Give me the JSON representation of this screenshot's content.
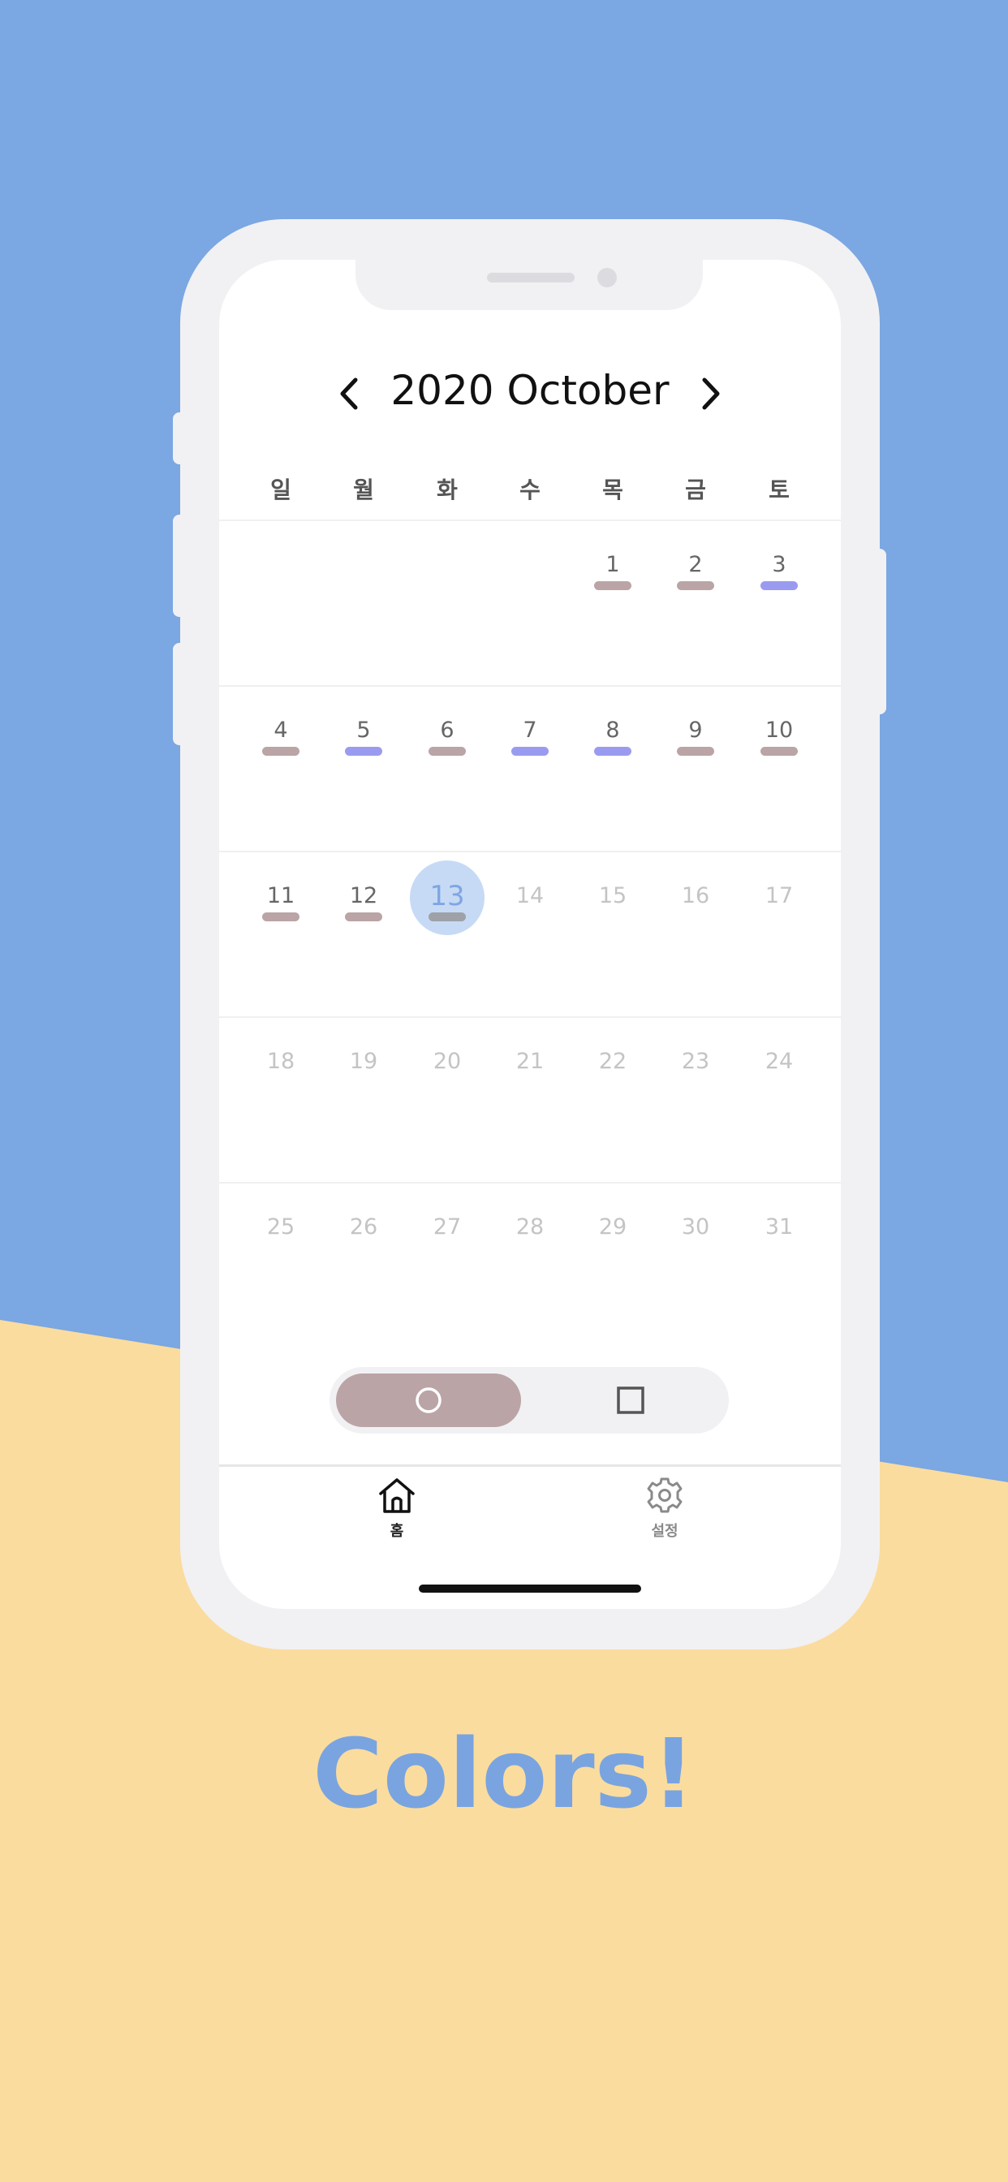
{
  "colors": {
    "background_top": "#7ba7e2",
    "background_bottom": "#fbdc9f",
    "bar_brown": "#bba4a6",
    "bar_purple": "#9a9bf0",
    "bar_gray": "#9ea1a7",
    "today_highlight": "#c6daf5",
    "tagline": "#79a4e0"
  },
  "header": {
    "month_title": "2020 October",
    "prev_icon": "chevron-left-icon",
    "next_icon": "chevron-right-icon"
  },
  "weekdays": [
    "일",
    "월",
    "화",
    "수",
    "목",
    "금",
    "토"
  ],
  "calendar": {
    "weeks": [
      [
        {
          "label": ""
        },
        {
          "label": ""
        },
        {
          "label": ""
        },
        {
          "label": ""
        },
        {
          "label": "1",
          "mark": "brown"
        },
        {
          "label": "2",
          "mark": "brown"
        },
        {
          "label": "3",
          "mark": "purple"
        }
      ],
      [
        {
          "label": "4",
          "mark": "brown"
        },
        {
          "label": "5",
          "mark": "purple"
        },
        {
          "label": "6",
          "mark": "brown"
        },
        {
          "label": "7",
          "mark": "purple"
        },
        {
          "label": "8",
          "mark": "purple"
        },
        {
          "label": "9",
          "mark": "brown"
        },
        {
          "label": "10",
          "mark": "brown"
        }
      ],
      [
        {
          "label": "11",
          "mark": "brown"
        },
        {
          "label": "12",
          "mark": "brown"
        },
        {
          "label": "13",
          "mark": "gray",
          "today": true
        },
        {
          "label": "14",
          "future": true
        },
        {
          "label": "15",
          "future": true
        },
        {
          "label": "16",
          "future": true
        },
        {
          "label": "17",
          "future": true
        }
      ],
      [
        {
          "label": "18",
          "future": true
        },
        {
          "label": "19",
          "future": true
        },
        {
          "label": "20",
          "future": true
        },
        {
          "label": "21",
          "future": true
        },
        {
          "label": "22",
          "future": true
        },
        {
          "label": "23",
          "future": true
        },
        {
          "label": "24",
          "future": true
        }
      ],
      [
        {
          "label": "25",
          "future": true
        },
        {
          "label": "26",
          "future": true
        },
        {
          "label": "27",
          "future": true
        },
        {
          "label": "28",
          "future": true
        },
        {
          "label": "29",
          "future": true
        },
        {
          "label": "30",
          "future": true
        },
        {
          "label": "31",
          "future": true
        }
      ]
    ]
  },
  "toggle": {
    "selected": "circle",
    "options": [
      {
        "icon": "circle-icon"
      },
      {
        "icon": "square-icon"
      }
    ]
  },
  "tabbar": {
    "home": {
      "label": "홈",
      "icon": "home-icon"
    },
    "settings": {
      "label": "설정",
      "icon": "gear-icon"
    }
  },
  "tagline": "Colors!"
}
